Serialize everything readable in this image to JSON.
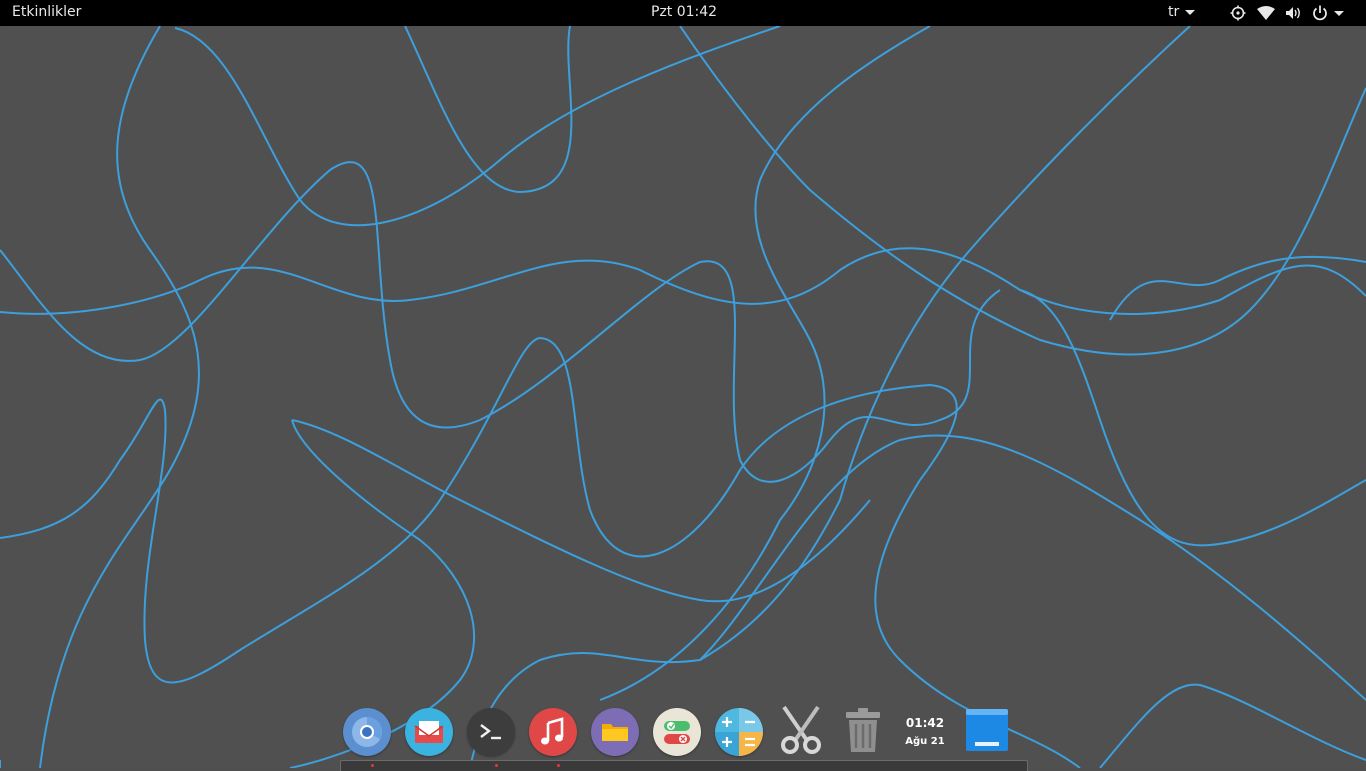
{
  "topbar": {
    "activities_label": "Etkinlikler",
    "clock_label": "Pzt 01:42",
    "language_label": "tr",
    "icons": [
      "accessibility-icon",
      "wifi-icon",
      "volume-icon",
      "power-icon"
    ]
  },
  "dock": {
    "items": [
      {
        "name": "chromium",
        "icon": "chromium-icon",
        "color": "#5b8fd0"
      },
      {
        "name": "mail",
        "icon": "mail-icon",
        "color": "#3ab3e0"
      },
      {
        "name": "terminal",
        "icon": "terminal-icon",
        "color": "#3d3d3d"
      },
      {
        "name": "music",
        "icon": "music-icon",
        "color": "#e04848"
      },
      {
        "name": "files",
        "icon": "folder-icon",
        "color": "#7d6db5"
      },
      {
        "name": "settings-toggles",
        "icon": "toggles-icon",
        "color": "#e9e6d8"
      },
      {
        "name": "calculator",
        "icon": "calculator-icon",
        "color": "#4fb8e0"
      },
      {
        "name": "screenshot",
        "icon": "scissors-icon",
        "color": "#d8d8d8"
      },
      {
        "name": "trash",
        "icon": "trash-icon",
        "color": "#9a9a9a"
      }
    ],
    "clock_time": "01:42",
    "clock_date": "Ağu 21",
    "desktop_icon": "show-desktop-icon"
  },
  "wallpaper": {
    "background_color": "#505050",
    "line_color": "#3d9fdb"
  }
}
